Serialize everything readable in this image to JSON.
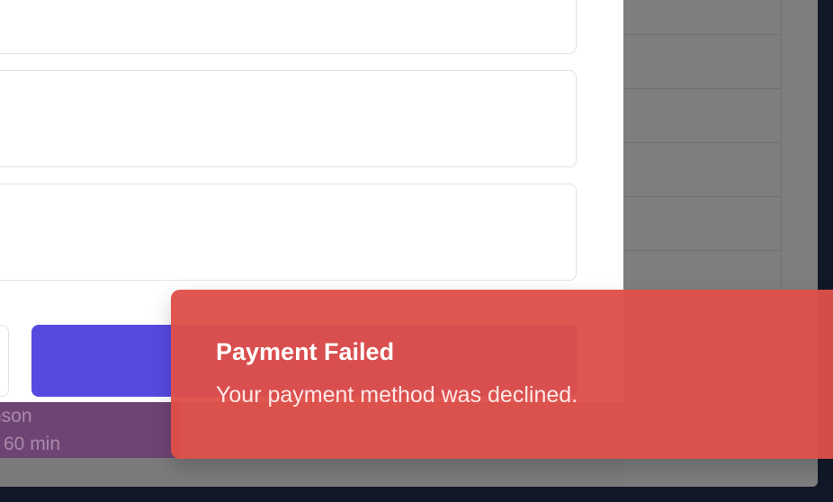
{
  "background": {
    "event": {
      "name_fragment": "nson",
      "duration_fragment": "60 min"
    }
  },
  "modal": {
    "primary_button_label": ""
  },
  "toast": {
    "title": "Payment Failed",
    "message": "Your payment method was declined.",
    "color": "#df4f49"
  }
}
